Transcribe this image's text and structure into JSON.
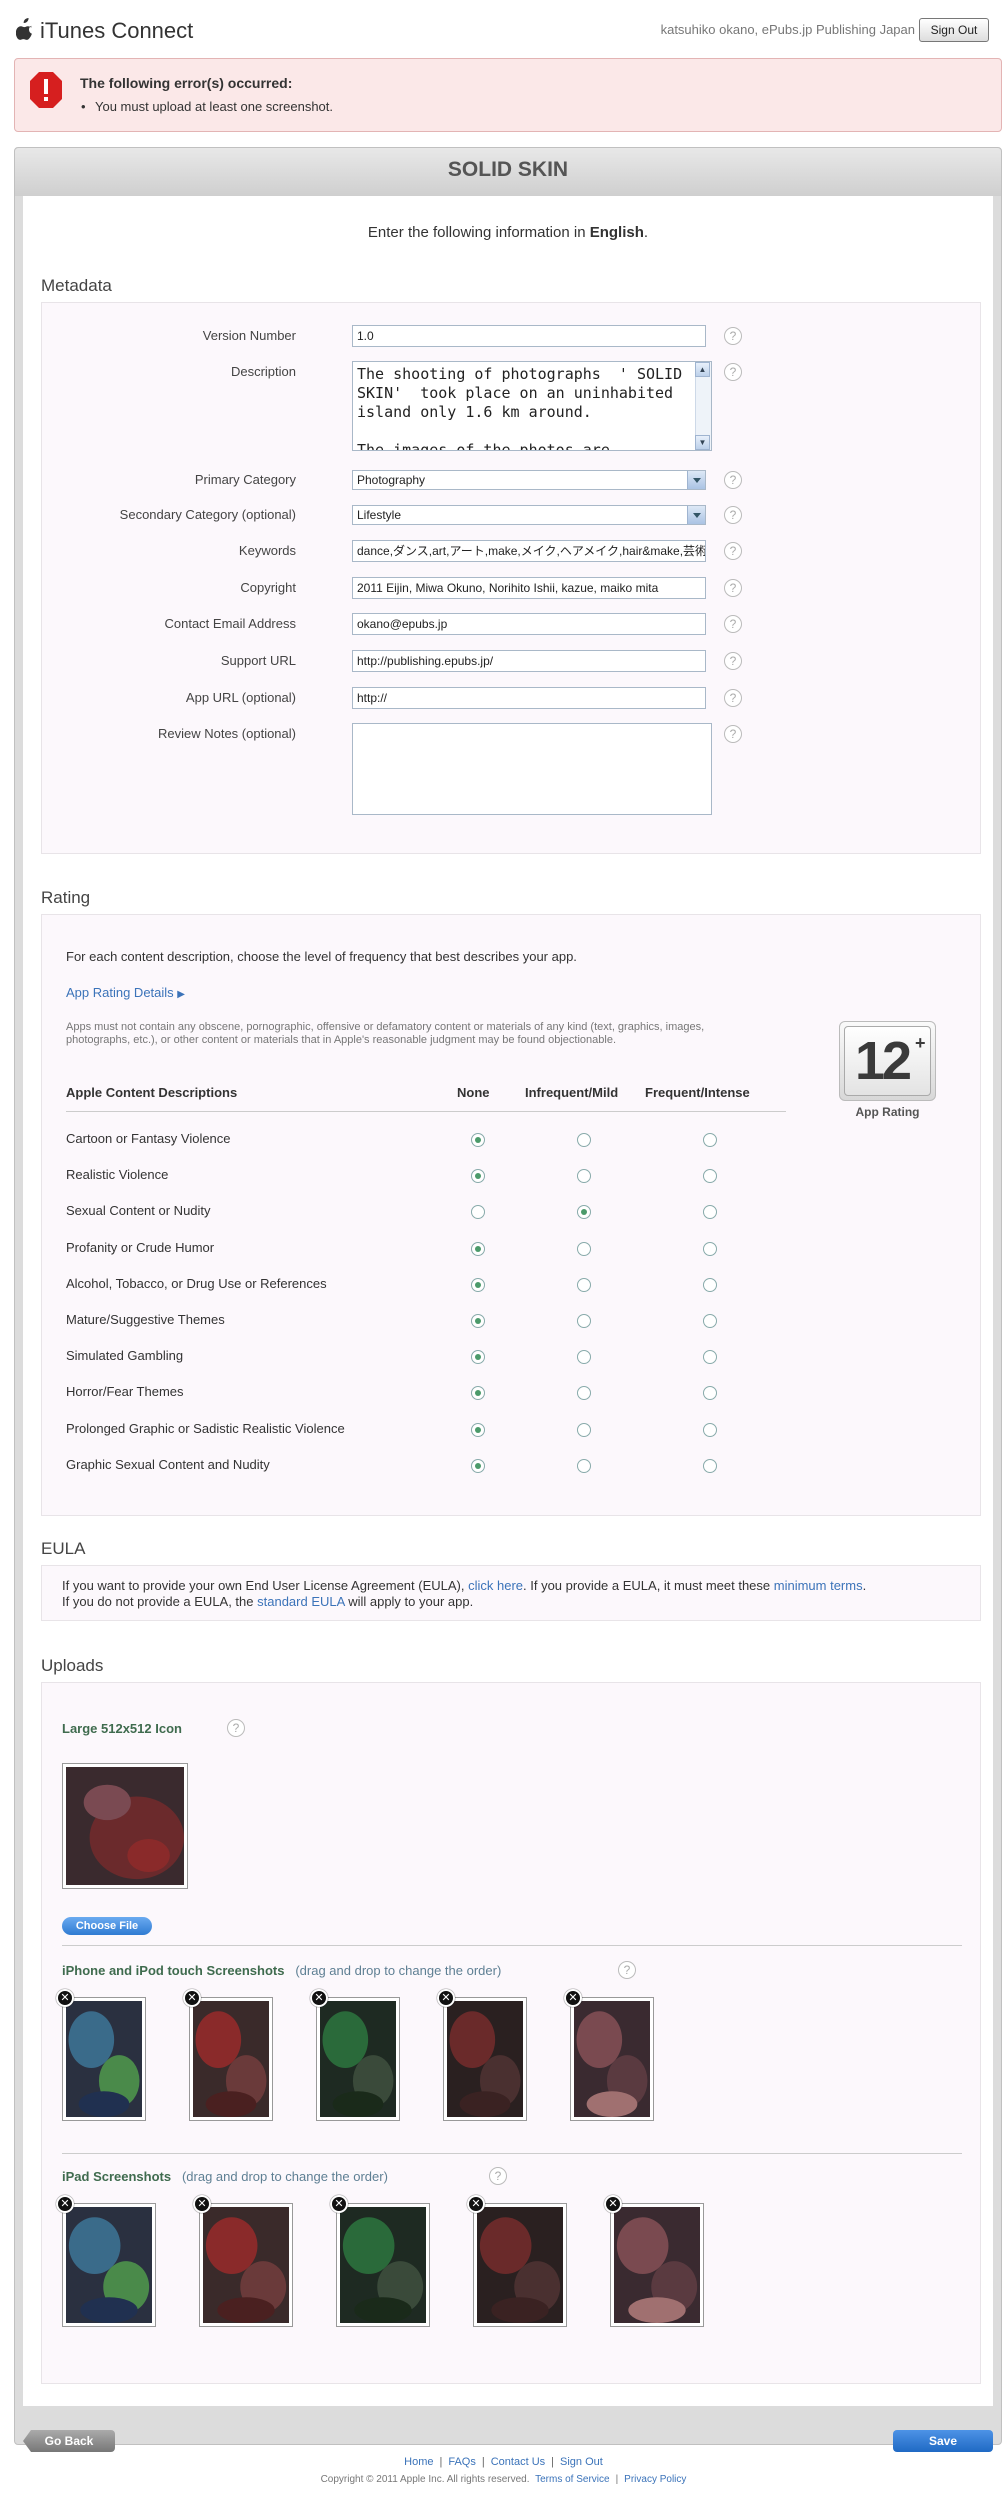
{
  "header": {
    "app_name": "iTunes Connect",
    "user_text": "katsuhiko okano, ePubs.jp Publishing Japan",
    "signout_label": "Sign Out"
  },
  "error": {
    "title": "The following error(s) occurred:",
    "items": [
      "You must upload at least one screenshot."
    ]
  },
  "app": {
    "title": "SOLID SKIN",
    "intro_prefix": "Enter the following information in",
    "intro_lang": "English",
    "intro_suffix": "."
  },
  "metadata": {
    "section_title": "Metadata",
    "version_label": "Version Number",
    "version_value": "1.0",
    "description_label": "Description",
    "description_value": "The shooting of photographs  ' SOLID SKIN'  took place on an uninhabited island only 1.6 km around.\n\nThe images of the photos are supposed",
    "primary_label": "Primary Category",
    "primary_value": "Photography",
    "secondary_label": "Secondary Category (optional)",
    "secondary_value": "Lifestyle",
    "keywords_label": "Keywords",
    "keywords_value": "dance,ダンス,art,アート,make,メイク,ヘアメイク,hair&make,芸術,踊り",
    "copyright_label": "Copyright",
    "copyright_value": "2011 Eijin, Miwa Okuno, Norihito Ishii, kazue, maiko mita",
    "email_label": "Contact Email Address",
    "email_value": "okano@epubs.jp",
    "support_label": "Support URL",
    "support_value": "http://publishing.epubs.jp/",
    "appurl_label": "App URL (optional)",
    "appurl_value": "http://",
    "notes_label": "Review Notes (optional)",
    "notes_value": "",
    "help_glyph": "?"
  },
  "rating": {
    "section_title": "Rating",
    "intro": "For each content description, choose the level of frequency that best describes your app.",
    "details_link": "App Rating Details",
    "disclaimer": "Apps must not contain any obscene, pornographic, offensive or defamatory content or materials of any kind (text, graphics, images, photographs, etc.), or other content or materials that in Apple's reasonable judgment may be found objectionable.",
    "col_desc": "Apple Content Descriptions",
    "col_none": "None",
    "col_mild": "Infrequent/Mild",
    "col_intense": "Frequent/Intense",
    "badge": "12",
    "badge_plus": "+",
    "badge_label": "App Rating",
    "rows": [
      {
        "label": "Cartoon or Fantasy Violence",
        "selected": 0
      },
      {
        "label": "Realistic Violence",
        "selected": 0
      },
      {
        "label": "Sexual Content or Nudity",
        "selected": 1
      },
      {
        "label": "Profanity or Crude Humor",
        "selected": 0
      },
      {
        "label": "Alcohol, Tobacco, or Drug Use or References",
        "selected": 0
      },
      {
        "label": "Mature/Suggestive Themes",
        "selected": 0
      },
      {
        "label": "Simulated Gambling",
        "selected": 0
      },
      {
        "label": "Horror/Fear Themes",
        "selected": 0
      },
      {
        "label": "Prolonged Graphic or Sadistic Realistic Violence",
        "selected": 0
      },
      {
        "label": "Graphic Sexual Content and Nudity",
        "selected": 0
      }
    ]
  },
  "eula": {
    "section_title": "EULA",
    "t1": "If you want to provide your own End User License Agreement (EULA), ",
    "link1": "click here",
    "t2": ". If you provide a EULA, it must meet these ",
    "link2": "minimum terms",
    "t3": ".",
    "t4": "If you do not provide a EULA, the ",
    "link3": "standard EULA",
    "t5": " will apply to your app."
  },
  "uploads": {
    "section_title": "Uploads",
    "icon_title": "Large 512x512 Icon",
    "choose_file": "Choose File",
    "iphone_title": "iPhone and iPod touch Screenshots",
    "ipad_title": "iPad Screenshots",
    "drag_hint": "(drag and drop to change the order)",
    "remove_glyph": "✕"
  },
  "footer": {
    "go_back": "Go Back",
    "save": "Save",
    "links": [
      "Home",
      "FAQs",
      "Contact Us",
      "Sign Out"
    ],
    "copyright": "Copyright © 2011 Apple Inc. All rights reserved.",
    "terms": "Terms of Service",
    "privacy": "Privacy Policy",
    "sep": "|"
  },
  "colors": {
    "accent": "#3b73b9",
    "save": "#2f7bd2",
    "error_bg": "#fbe8e8"
  }
}
